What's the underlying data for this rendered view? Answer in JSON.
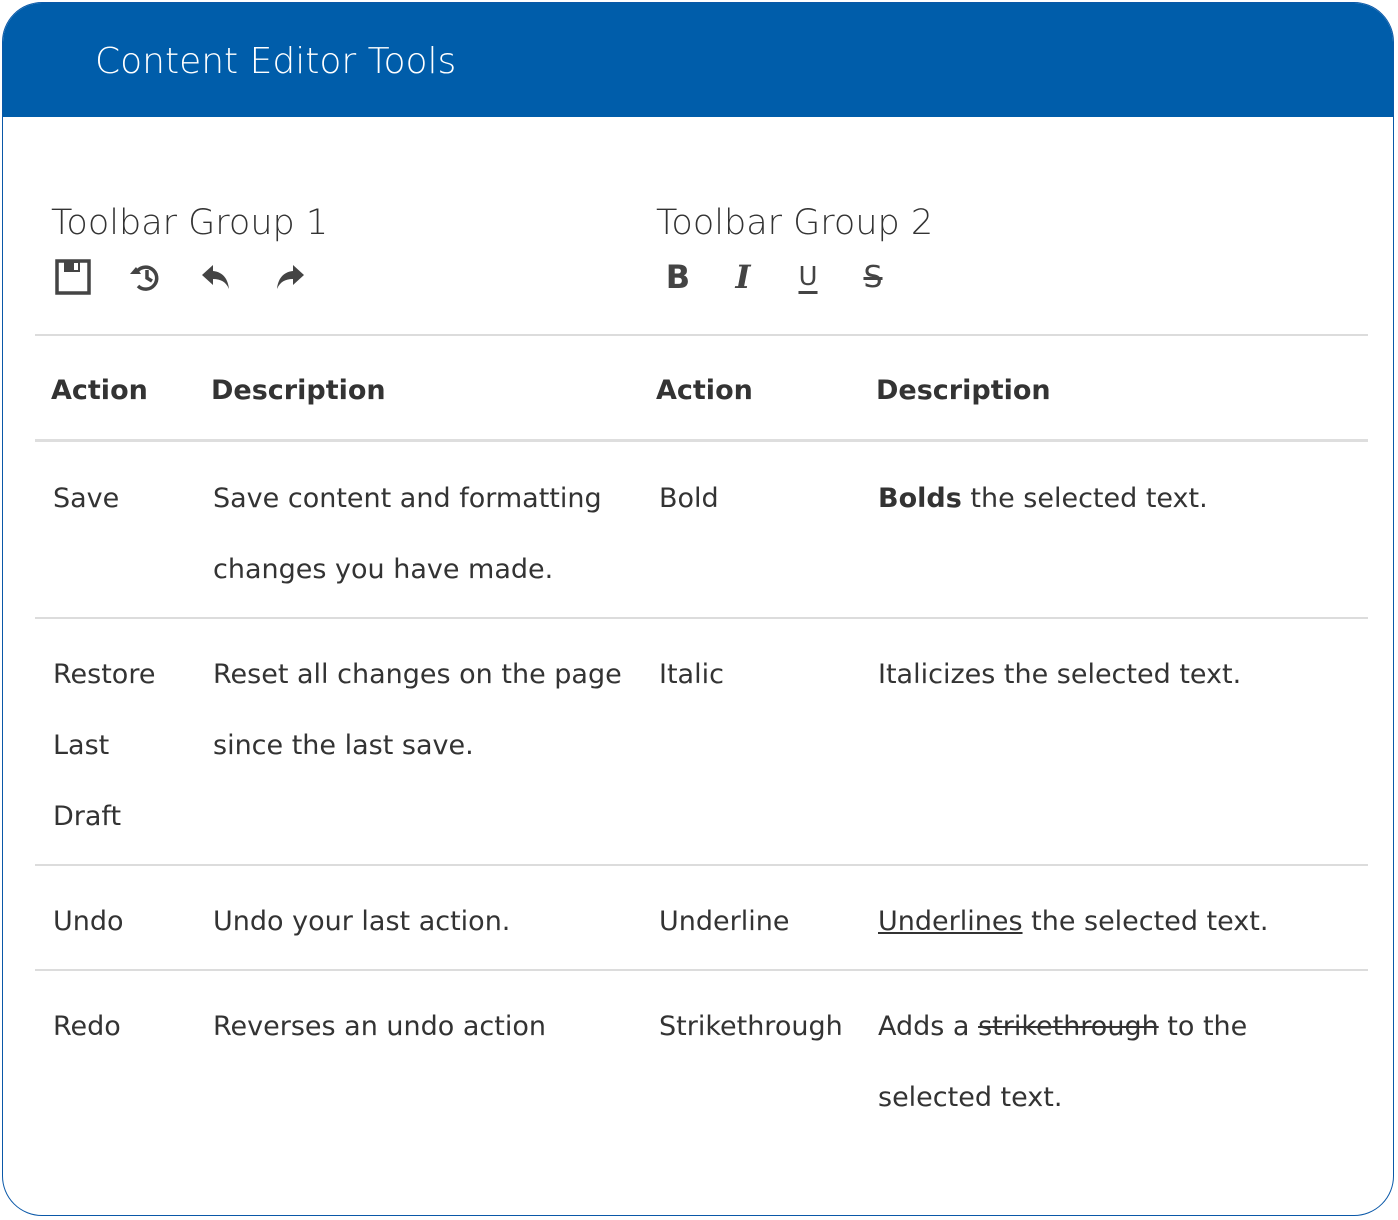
{
  "header": {
    "title": "Content Editor Tools"
  },
  "group1": {
    "title": "Toolbar Group 1",
    "icons": [
      "save-icon",
      "restore-history-icon",
      "undo-icon",
      "redo-icon"
    ]
  },
  "group2": {
    "title": "Toolbar Group 2",
    "icons": {
      "bold": "B",
      "italic": "I",
      "underline": "U",
      "strikethrough": "S"
    }
  },
  "table": {
    "headers": [
      "Action",
      "Description",
      "Action",
      "Description"
    ],
    "rows": [
      {
        "action1": "Save",
        "desc1": "Save content and formatting changes you have made.",
        "action2": "Bold",
        "desc2": {
          "styled": "Bolds",
          "rest": " the selected text."
        }
      },
      {
        "action1": "Restore Last Draft",
        "desc1": "Reset all changes on the page since the last save.",
        "action2": "Italic",
        "desc2": {
          "text": "Italicizes the selected text."
        }
      },
      {
        "action1": "Undo",
        "desc1": "Undo your last action.",
        "action2": "Underline",
        "desc2": {
          "styled": "Underlines",
          "rest": " the selected text."
        }
      },
      {
        "action1": "Redo",
        "desc1": "Reverses an undo action",
        "action2": "Strikethrough",
        "desc2": {
          "pre": "Adds a ",
          "styled": "strikethrough",
          "rest": " to the selected text."
        }
      }
    ]
  },
  "colors": {
    "header_bg": "#005daa",
    "border": "#0a58a8",
    "rule": "#dcdcdc"
  }
}
